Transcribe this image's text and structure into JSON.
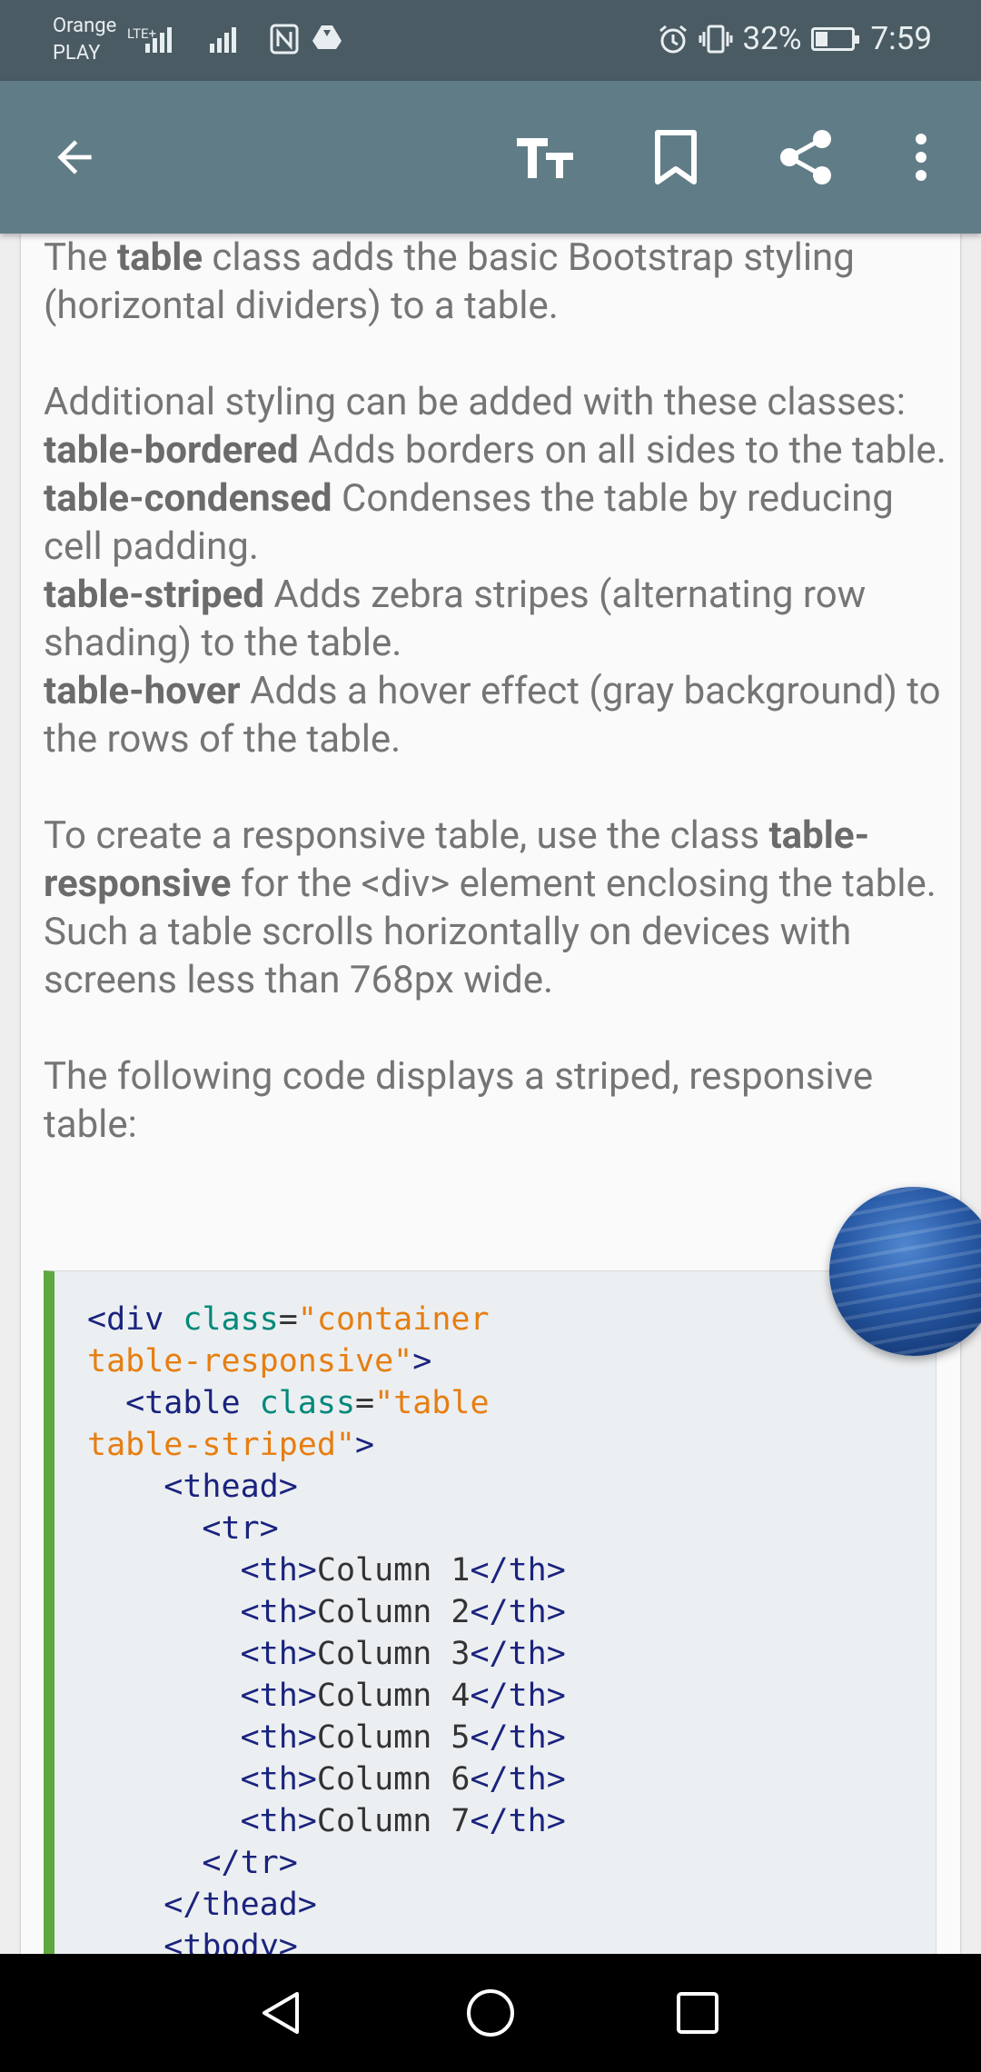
{
  "status_bar": {
    "carrier": "Orange",
    "carrier2": "PLAY",
    "network": "LTE+",
    "battery": "32%",
    "time": "7:59",
    "icons": [
      "signal-icon",
      "signal-icon",
      "nfc-icon",
      "drive-icon",
      "alarm-icon",
      "vibrate-icon",
      "battery-icon"
    ]
  },
  "app_bar": {
    "icons": [
      "back-arrow-icon",
      "text-size-icon",
      "bookmark-icon",
      "share-icon",
      "more-vert-icon"
    ]
  },
  "content": {
    "intro": {
      "pre": "The ",
      "bold": "table",
      "post": " class adds the basic Bootstrap styling (horizontal dividers) to a table."
    },
    "additional": "Additional styling can be added with these classes:",
    "classes": [
      {
        "name": "table-bordered",
        "desc": " Adds borders on all sides to the table."
      },
      {
        "name": "table-condensed",
        "desc": " Condenses the table by reducing cell padding."
      },
      {
        "name": "table-striped",
        "desc": " Adds zebra stripes (alternating row shading) to the table."
      },
      {
        "name": "table-hover",
        "desc": " Adds a hover effect (gray background) to the rows of the table."
      }
    ],
    "responsive": {
      "pre": "To create a responsive table, use the class ",
      "bold": "table-responsive",
      "post": " for the <div> element enclosing the table. Such a table scrolls horizontally on devices with screens less than 768px wide."
    },
    "following": "The following code displays a striped, responsive table:"
  },
  "code": {
    "div_open": "<div",
    "div_attr": "class",
    "div_val": "\"container",
    "div_val2": "table-responsive\"",
    "div_close": ">",
    "table_open": "  <table",
    "table_attr": "class",
    "table_val": "\"table",
    "table_val2": "table-striped\"",
    "table_close": ">",
    "thead_open": "    <thead>",
    "tr_open": "      <tr>",
    "th_open": "<th>",
    "th_close": "</th>",
    "th_indent": "        ",
    "columns": [
      "Column 1",
      "Column 2",
      "Column 3",
      "Column 4",
      "Column 5",
      "Column 6",
      "Column 7"
    ],
    "tr_close": "      </tr>",
    "thead_close": "    </thead>",
    "tbody_open": "    <tbody>"
  },
  "colors": {
    "status_bar": "#4b5b63",
    "app_bar": "#607d87",
    "code_accent": "#5fa83f",
    "code_attr": "#00897b",
    "code_string": "#e67e12",
    "code_tag": "#1a237e"
  },
  "navbar": {
    "icons": [
      "back-triangle-icon",
      "home-circle-icon",
      "recents-square-icon"
    ]
  }
}
